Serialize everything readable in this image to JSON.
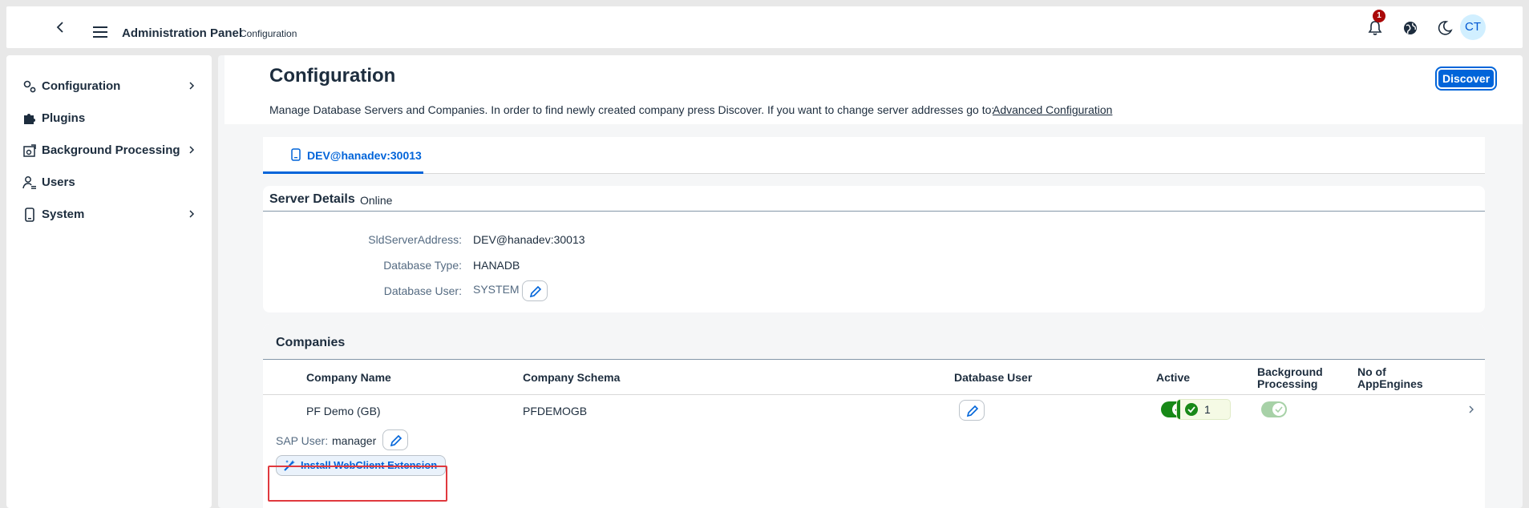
{
  "shell": {
    "title": "Administration Panel",
    "subtitle": "Configuration",
    "notification_count": "1",
    "avatar_initials": "CT"
  },
  "sidebar": {
    "items": [
      {
        "label": "Configuration",
        "icon": "gears-icon",
        "has_children": true
      },
      {
        "label": "Plugins",
        "icon": "puzzle-icon",
        "has_children": false
      },
      {
        "label": "Background Processing",
        "icon": "background-processing-icon",
        "has_children": true
      },
      {
        "label": "Users",
        "icon": "users-icon",
        "has_children": false
      },
      {
        "label": "System",
        "icon": "device-icon",
        "has_children": true
      }
    ]
  },
  "main": {
    "title": "Configuration",
    "discover_label": "Discover",
    "description": "Manage Database Servers and Companies. In order to find newly created company press Discover. If you want to change server addresses go to:",
    "advanced_link": "Advanced Configuration",
    "tabs": [
      {
        "label": "DEV@hanadev:30013",
        "selected": true
      }
    ]
  },
  "server_details": {
    "title": "Server Details",
    "status": "Online",
    "fields": [
      {
        "label": "SldServerAddress:",
        "value": "DEV@hanadev:30013"
      },
      {
        "label": "Database Type:",
        "value": "HANADB"
      },
      {
        "label": "Database User:",
        "value": "SYSTEM"
      }
    ]
  },
  "companies": {
    "title": "Companies",
    "columns": {
      "company_name": "Company Name",
      "company_schema": "Company Schema",
      "database_user": "Database User",
      "active": "Active",
      "background_line1": "Background",
      "background_line2": "Processing",
      "app_engines_line1": "No of",
      "app_engines_line2": "AppEngines"
    },
    "rows": [
      {
        "company_name": "PF Demo (GB)",
        "company_schema": "PFDEMOGB",
        "active": true,
        "background_processing": true,
        "app_engines": "1",
        "sap_user_label": "SAP User:",
        "sap_user_value": "manager",
        "install_label": "Install WebClient Extension"
      }
    ]
  },
  "colors": {
    "accent": "#0064d9",
    "positive": "#188918",
    "highlight": "#e0393e"
  }
}
